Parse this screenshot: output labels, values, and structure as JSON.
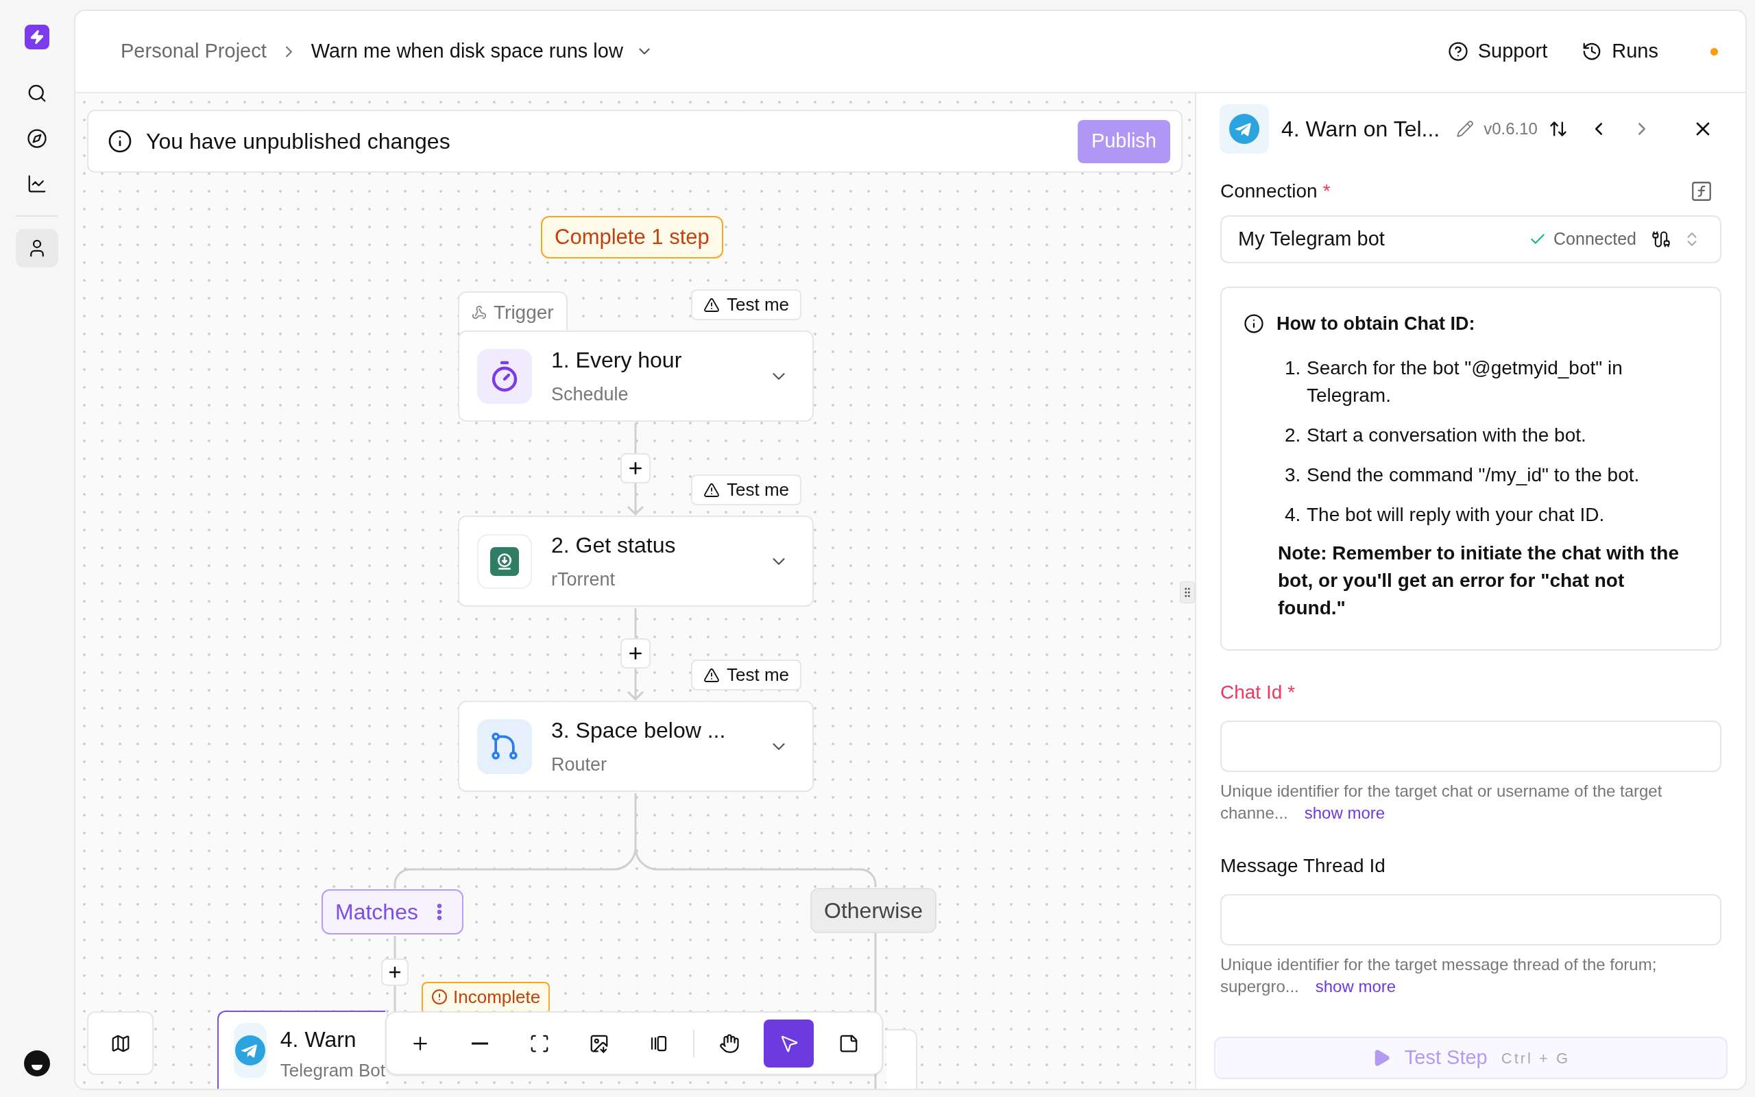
{
  "sidebar": {
    "items": [
      {
        "kind": "search",
        "selected": false
      },
      {
        "kind": "explore",
        "selected": false
      },
      {
        "kind": "analytics",
        "selected": false
      },
      {
        "kind": "profile",
        "selected": true
      }
    ]
  },
  "header": {
    "breadcrumb": [
      "Personal Project",
      "Warn me when disk space runs low"
    ],
    "actions": [
      {
        "kind": "support",
        "label": "Support"
      },
      {
        "kind": "runs",
        "label": "Runs"
      }
    ]
  },
  "banner": {
    "message": "You have unpublished changes",
    "button": {
      "label": "Publish",
      "disabled": true
    }
  },
  "canvas": {
    "warning": "Complete 1 step",
    "trigger_label": "Trigger",
    "steps": [
      {
        "kind": "schedule",
        "title": "1. Every hour",
        "subtitle": "Schedule",
        "test": "Test me"
      },
      {
        "kind": "rtorrent",
        "title": "2. Get status",
        "subtitle": "rTorrent",
        "test": "Test me"
      },
      {
        "kind": "router",
        "title": "3. Space below ...",
        "subtitle": "Router",
        "test": "Test me"
      }
    ],
    "branches": [
      {
        "label": "Matches",
        "selected": true
      },
      {
        "label": "Otherwise",
        "selected": false
      }
    ],
    "branch_step": {
      "kind": "telegram",
      "title": "4. Warn",
      "subtitle": "Telegram Bot",
      "selected": true,
      "badge": "Incomplete"
    }
  },
  "toolbar": {
    "groups": [
      [
        {
          "kind": "zoom_in",
          "selected": false
        },
        {
          "kind": "zoom_out",
          "selected": false
        },
        {
          "kind": "fit",
          "selected": false
        },
        {
          "kind": "export",
          "selected": false
        },
        {
          "kind": "panel",
          "selected": false
        }
      ],
      [
        {
          "kind": "hand",
          "selected": false
        },
        {
          "kind": "select",
          "selected": true
        },
        {
          "kind": "note",
          "selected": false
        }
      ]
    ]
  },
  "panel": {
    "title": "4. Warn on Tel...",
    "version": "v0.6.10",
    "connection": {
      "label": "Connection",
      "required": "*",
      "value": "My Telegram bot",
      "status": "Connected"
    },
    "instructions": {
      "title": "How to obtain Chat ID:",
      "steps": [
        {
          "number": "1.",
          "text": "Search for the bot \"@getmyid_bot\" in Telegram."
        },
        {
          "number": "2.",
          "text": "Start a conversation with the bot."
        },
        {
          "number": "3.",
          "text": "Send the command \"/my_id\" to the bot."
        },
        {
          "number": "4.",
          "text": "The bot will reply with your chat ID."
        }
      ],
      "note": "Note: Remember to initiate the chat with the bot, or you'll get an error for \"chat not found.\""
    },
    "fields": [
      {
        "label": "Chat Id",
        "required": "*",
        "error": true,
        "help": "Unique identifier for the target chat or username of the target channe...",
        "show_more": "show more"
      },
      {
        "label": "Message Thread Id",
        "error": false,
        "help": "Unique identifier for the target message thread of the forum; supergro...",
        "show_more": "show more"
      }
    ],
    "test_button": {
      "label": "Test Step",
      "shortcut": "Ctrl + G",
      "disabled": true
    }
  }
}
